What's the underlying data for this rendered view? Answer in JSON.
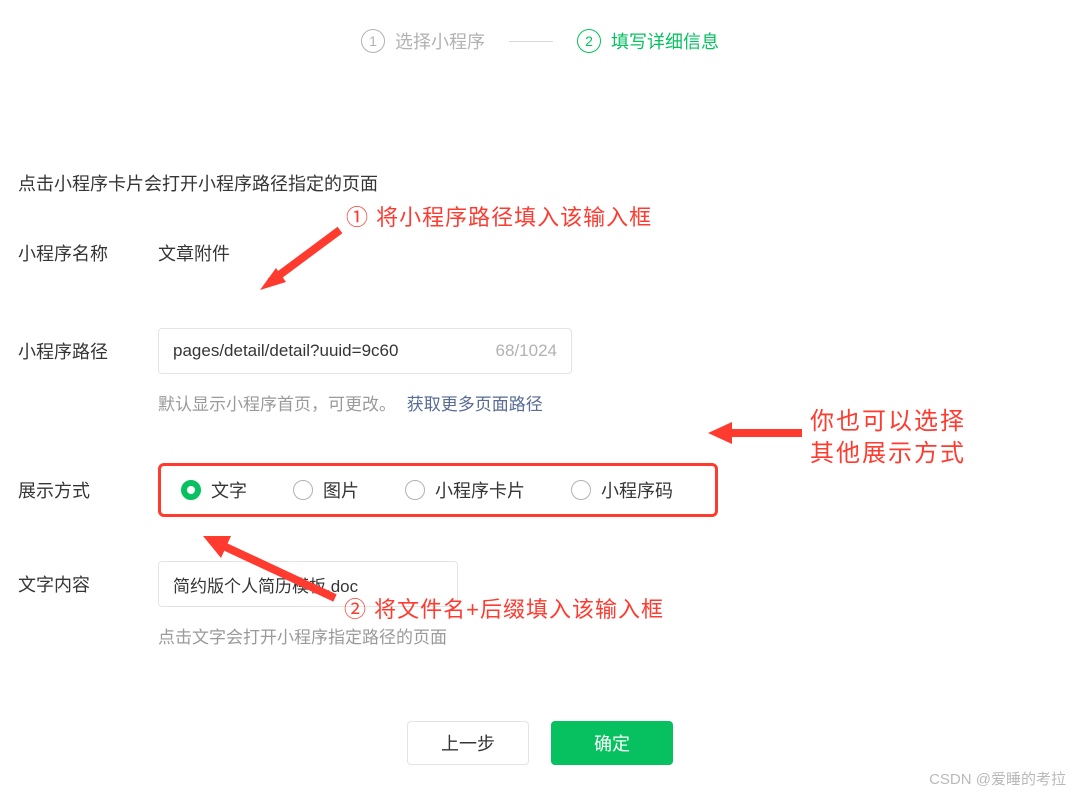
{
  "stepper": {
    "step1_num": "1",
    "step1_label": "选择小程序",
    "step2_num": "2",
    "step2_label": "填写详细信息"
  },
  "intro": "点击小程序卡片会打开小程序路径指定的页面",
  "name_field": {
    "label": "小程序名称",
    "value": "文章附件"
  },
  "path_field": {
    "label": "小程序路径",
    "value": "pages/detail/detail?uuid=9c60",
    "counter": "68/1024",
    "hint_prefix": "默认显示小程序首页，可更改。",
    "hint_link": "获取更多页面路径"
  },
  "display_field": {
    "label": "展示方式",
    "options": [
      "文字",
      "图片",
      "小程序卡片",
      "小程序码"
    ],
    "selected_index": 0
  },
  "text_field": {
    "label": "文字内容",
    "value": "简约版个人简历模板.doc",
    "hint": "点击文字会打开小程序指定路径的页面"
  },
  "actions": {
    "back": "上一步",
    "confirm": "确定"
  },
  "annotations": {
    "a1": "① 将小程序路径填入该输入框",
    "a2": "② 将文件名+后缀填入该输入框",
    "right1": "你也可以选择",
    "right2": "其他展示方式"
  },
  "watermark": "CSDN @爱睡的考拉"
}
